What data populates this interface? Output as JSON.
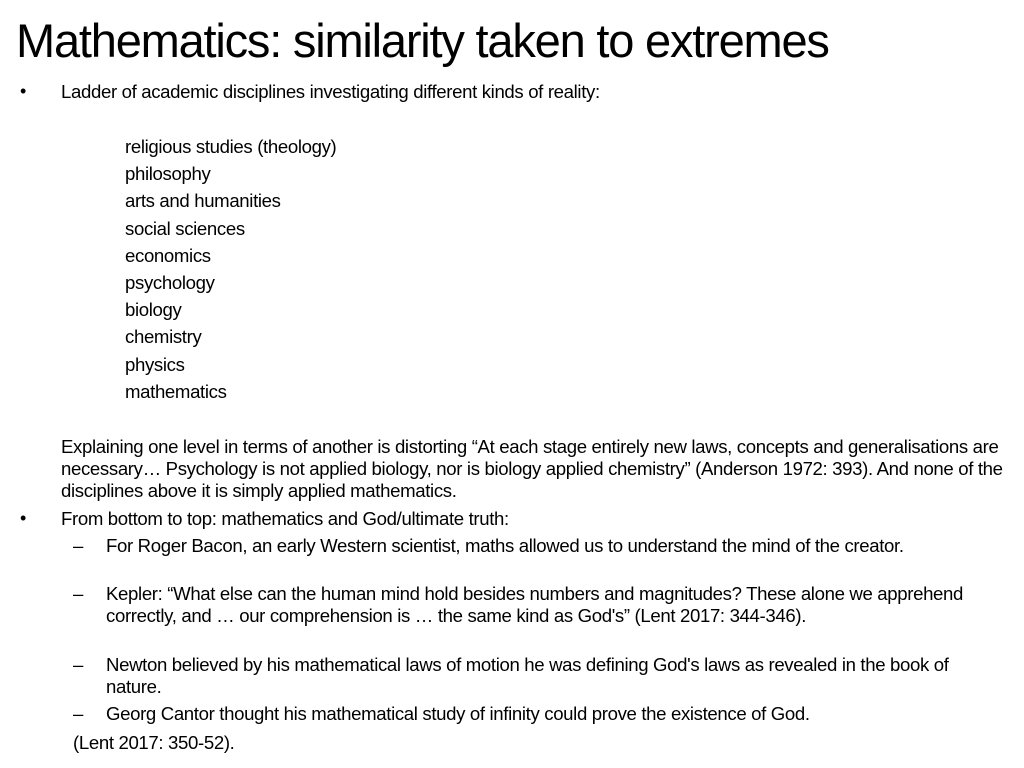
{
  "title": "Mathematics: similarity taken to extremes",
  "bullet_glyph": "•",
  "dash_glyph": "–",
  "bullets": [
    {
      "text": "Ladder of academic disciplines investigating different kinds of reality:",
      "ladder": [
        "religious studies (theology)",
        "philosophy",
        "arts and humanities",
        "social sciences",
        "economics",
        "psychology",
        "biology",
        "chemistry",
        "physics",
        "mathematics"
      ],
      "explanation": "Explaining one level in terms of another is distorting “At each stage entirely new laws, concepts and generalisations are necessary… Psychology is not applied biology, nor is biology applied chemistry” (Anderson 1972: 393). And none of the disciplines above it is simply applied mathematics."
    },
    {
      "text": "From bottom to top: mathematics and God/ultimate truth:",
      "subitems": [
        "For Roger Bacon, an early Western scientist, maths allowed us to understand the mind of the creator.",
        "Kepler: “What else can the human mind hold besides numbers and magnitudes? These alone we apprehend correctly, and … our comprehension is … the same kind as God's” (Lent 2017: 344-346).",
        "Newton believed by his mathematical laws of motion he was defining God's laws as revealed in the book of nature.",
        "Georg Cantor thought his mathematical study of infinity could prove the existence of God."
      ],
      "reference": "(Lent 2017: 350-52)."
    }
  ]
}
